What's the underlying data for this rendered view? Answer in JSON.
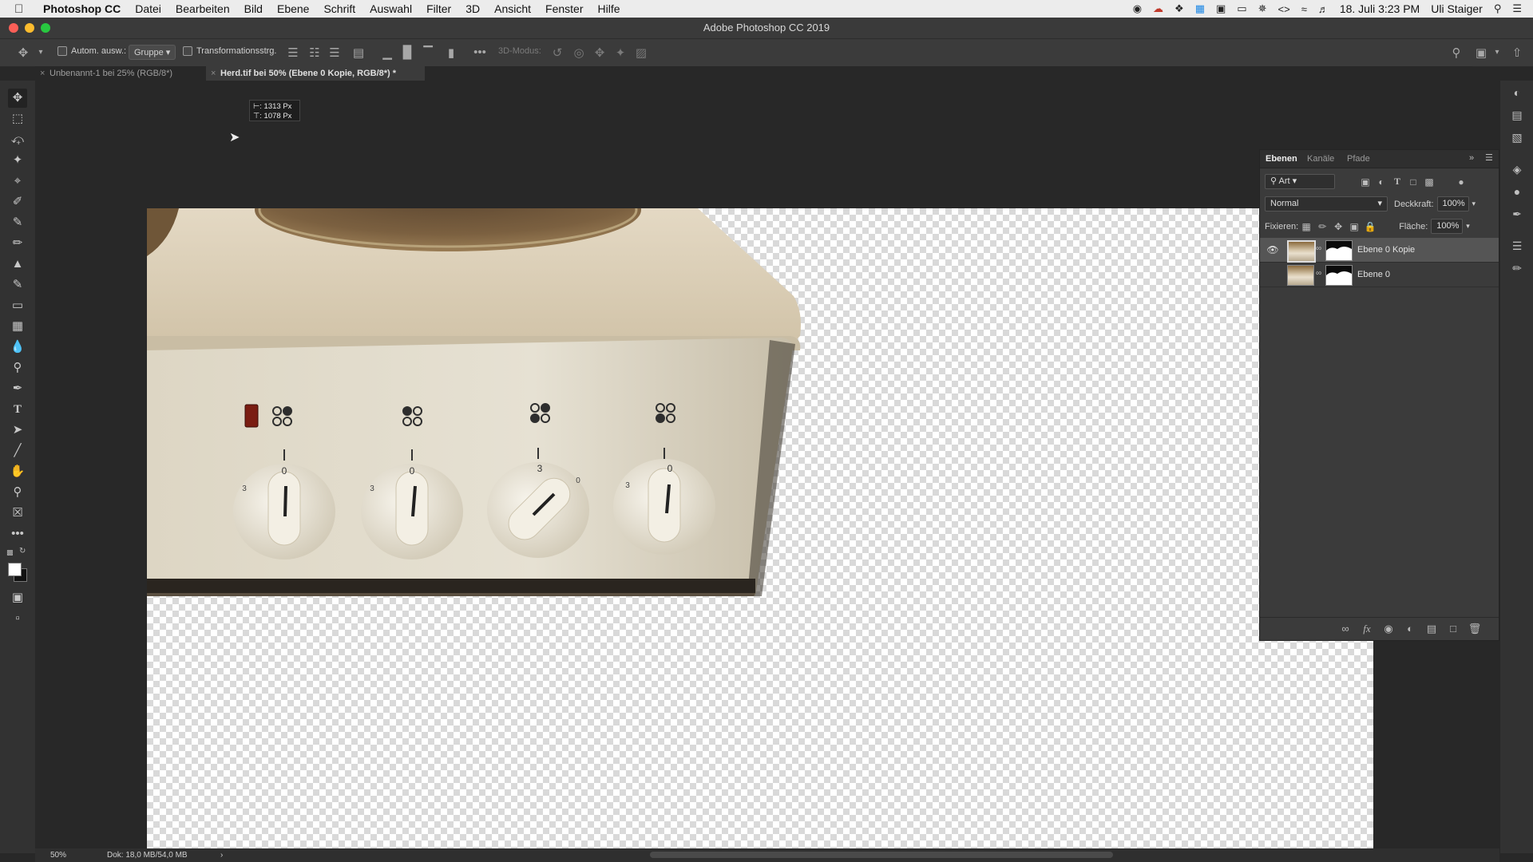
{
  "menubar": {
    "app_name": "Photoshop CC",
    "items": [
      "Datei",
      "Bearbeiten",
      "Bild",
      "Ebene",
      "Schrift",
      "Auswahl",
      "Filter",
      "3D",
      "Ansicht",
      "Fenster",
      "Hilfe"
    ],
    "date_time": "18. Juli  3:23 PM",
    "user": "Uli Staiger"
  },
  "window": {
    "title": "Adobe Photoshop CC 2019"
  },
  "options_bar": {
    "auto_select_label": "Autom. ausw.:",
    "auto_select_mode": "Gruppe",
    "transform_controls_label": "Transformationsstrg.",
    "mode_3d_label": "3D-Modus:"
  },
  "document_tabs": [
    {
      "label": "Unbenannt-1 bei 25% (RGB/8*)"
    },
    {
      "label": "Herd.tif bei 50% (Ebene 0 Kopie, RGB/8*) *"
    }
  ],
  "size_tooltip": {
    "width": "⊢: 1313 Px",
    "height": "⊤: 1078 Px"
  },
  "layers_panel": {
    "tabs": [
      "Ebenen",
      "Kanäle",
      "Pfade"
    ],
    "filter_kind": "Art",
    "blend_mode": "Normal",
    "opacity_label": "Deckkraft:",
    "opacity_value": "100%",
    "lock_label": "Fixieren:",
    "fill_label": "Fläche:",
    "fill_value": "100%",
    "layers": [
      {
        "name": "Ebene 0 Kopie",
        "visible": true,
        "selected": true
      },
      {
        "name": "Ebene 0",
        "visible": false,
        "selected": false
      }
    ]
  },
  "stove": {
    "knob_labels": [
      "0",
      "0",
      "3",
      "0"
    ],
    "knob_side_labels": [
      "3",
      "3",
      "0",
      "3"
    ]
  },
  "statusbar": {
    "zoom": "50%",
    "doc_size": "Dok: 18,0 MB/54,0 MB"
  },
  "colors": {
    "foreground": "#ffffff",
    "background": "#000000",
    "indicator_red": "#c0392b"
  },
  "icons": {
    "menubar_right": [
      "record-icon",
      "creative-cloud-icon",
      "dropbox-icon",
      "skype-icon",
      "display-icon",
      "airplay-icon",
      "bluetooth-icon",
      "code-icon",
      "wifi-icon",
      "volume-icon",
      "spotlight-icon",
      "notification-center-icon"
    ]
  }
}
